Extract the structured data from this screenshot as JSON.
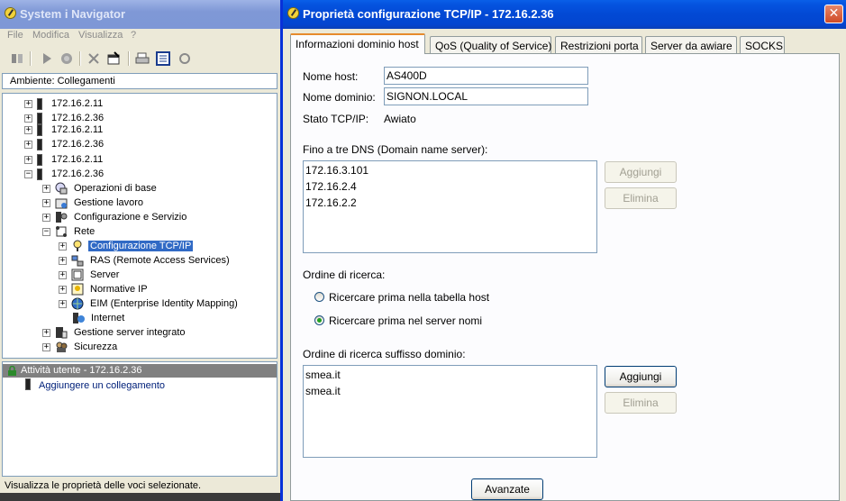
{
  "navigator": {
    "title": "System i Navigator",
    "menu": [
      "File",
      "Modifica",
      "Visualizza",
      "?"
    ],
    "environment": "Ambiente: Collegamenti",
    "tree": [
      {
        "label": "172.16.2.11",
        "kind": "system"
      },
      {
        "label": "172.16.2.36",
        "kind": "system"
      },
      {
        "label": "172.16.2.11",
        "kind": "system"
      },
      {
        "label": "172.16.2.36",
        "kind": "system"
      },
      {
        "label": "172.16.2.11",
        "kind": "system"
      },
      {
        "label": "172.16.2.36",
        "kind": "system"
      },
      {
        "label": "Operazioni di base",
        "kind": "node"
      },
      {
        "label": "Gestione lavoro",
        "kind": "node"
      },
      {
        "label": "Configurazione e Servizio",
        "kind": "node"
      },
      {
        "label": "Rete",
        "kind": "node"
      },
      {
        "label": "Configurazione TCP/IP",
        "kind": "node",
        "selected": true
      },
      {
        "label": "RAS (Remote Access Services)",
        "kind": "node"
      },
      {
        "label": "Server",
        "kind": "node"
      },
      {
        "label": "Normative IP",
        "kind": "node"
      },
      {
        "label": "EIM (Enterprise Identity Mapping)",
        "kind": "node"
      },
      {
        "label": "Internet",
        "kind": "node"
      },
      {
        "label": "Gestione server integrato",
        "kind": "node"
      },
      {
        "label": "Sicurezza",
        "kind": "node"
      }
    ],
    "activity_header": "Attività utente - 172.16.2.36",
    "activity_link": "Aggiungere un collegamento",
    "status": "Visualizza le proprietà delle voci selezionate."
  },
  "dialog": {
    "title": "Proprietà configurazione TCP/IP - 172.16.2.36",
    "tabs": [
      "Informazioni dominio host",
      "QoS (Quality of Service)",
      "Restrizioni porta",
      "Server da awiare",
      "SOCKS"
    ],
    "host_label": "Nome host:",
    "host_value": "AS400D",
    "domain_label": "Nome dominio:",
    "domain_value": "SIGNON.LOCAL",
    "status_label": "Stato TCP/IP:",
    "status_value": "Awiato",
    "dns_label": "Fino a tre DNS (Domain name server):",
    "dns_servers": [
      "172.16.3.101",
      "172.16.2.4",
      "172.16.2.2"
    ],
    "add_label": "Aggiungi",
    "remove_label": "Elimina",
    "search_order_label": "Ordine di ricerca:",
    "search_host_first": "Ricercare prima nella tabella host",
    "search_server_first": "Ricercare prima nel server nomi",
    "search_selected": "server",
    "suffix_label": "Ordine di ricerca suffisso dominio:",
    "suffixes": [
      "smea.it",
      "smea.it"
    ],
    "advanced_label": "Avanzate"
  },
  "colors": {
    "selection": "#316ac5",
    "xp_title_active": "#0249d4",
    "xp_title_inactive": "#7f98d6",
    "tab_highlight": "#e68b2c"
  }
}
